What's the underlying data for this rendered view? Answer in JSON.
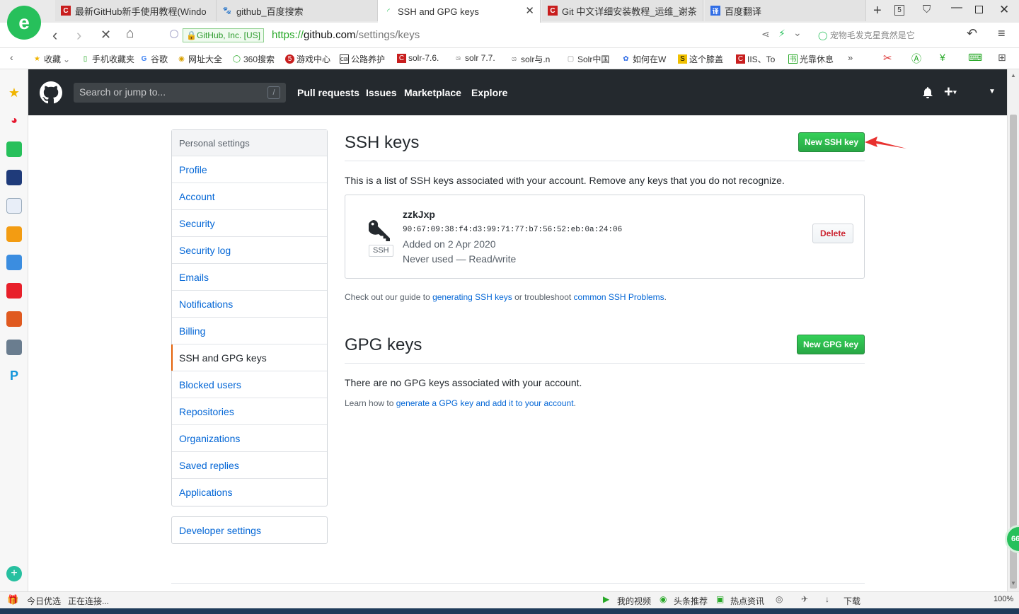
{
  "browser": {
    "tabs": [
      {
        "title": "最新GitHub新手使用教程(Windo",
        "active": false
      },
      {
        "title": "github_百度搜索",
        "active": false
      },
      {
        "title": "SSH and GPG keys",
        "active": true
      },
      {
        "title": "Git 中文详细安装教程_运维_谢茶",
        "active": false
      },
      {
        "title": "百度翻译",
        "active": false
      }
    ],
    "tab_count": "5",
    "security_badge": "GitHub, Inc. [US]",
    "url_scheme": "https://",
    "url_host": "github.com",
    "url_path": "/settings/keys",
    "search_suggestion": "宠物毛发克星竟然是它",
    "bookmarks": [
      "收藏",
      "手机收藏夹",
      "谷歌",
      "网址大全",
      "360搜索",
      "游戏中心",
      "公路养护",
      "solr-7.6.",
      "solr 7.7.",
      "solr与.n",
      "Solr中国",
      "如何在W",
      "这个膝盖",
      "IIS、To",
      "光靠休息"
    ],
    "status_left": [
      "今日优选",
      "正在连接..."
    ],
    "status_right": [
      "我的视频",
      "头条推荐",
      "热点资讯",
      "下载",
      "100%"
    ],
    "side_badge": "66"
  },
  "github": {
    "search_placeholder": "Search or jump to...",
    "search_shortcut": "/",
    "nav": [
      "Pull requests",
      "Issues",
      "Marketplace",
      "Explore"
    ],
    "menu_heading": "Personal settings",
    "menu_items": [
      "Profile",
      "Account",
      "Security",
      "Security log",
      "Emails",
      "Notifications",
      "Billing",
      "SSH and GPG keys",
      "Blocked users",
      "Repositories",
      "Organizations",
      "Saved replies",
      "Applications"
    ],
    "selected_item": "SSH and GPG keys",
    "developer_settings": "Developer settings",
    "ssh": {
      "heading": "SSH keys",
      "new_button": "New SSH key",
      "description": "This is a list of SSH keys associated with your account. Remove any keys that you do not recognize.",
      "key": {
        "title": "zzkJxp",
        "fingerprint": "90:67:09:38:f4:d3:99:71:77:b7:56:52:eb:0a:24:06",
        "added": "Added on 2 Apr 2020",
        "usage": "Never used — Read/write",
        "badge": "SSH",
        "delete_label": "Delete"
      },
      "guide_prefix": "Check out our guide to ",
      "guide_link1": "generating SSH keys",
      "guide_middle": " or troubleshoot ",
      "guide_link2": "common SSH Problems",
      "guide_suffix": "."
    },
    "gpg": {
      "heading": "GPG keys",
      "new_button": "New GPG key",
      "empty_text": "There are no GPG keys associated with your account.",
      "learn_prefix": "Learn how to ",
      "learn_link": "generate a GPG key and add it to your account",
      "learn_suffix": "."
    }
  },
  "colors": {
    "primary_green": "#28a745",
    "link_blue": "#0366d6",
    "header_dark": "#24292e",
    "danger_red": "#cb2431",
    "selected_marker": "#e36209",
    "annotation_arrow": "#e8312f"
  }
}
